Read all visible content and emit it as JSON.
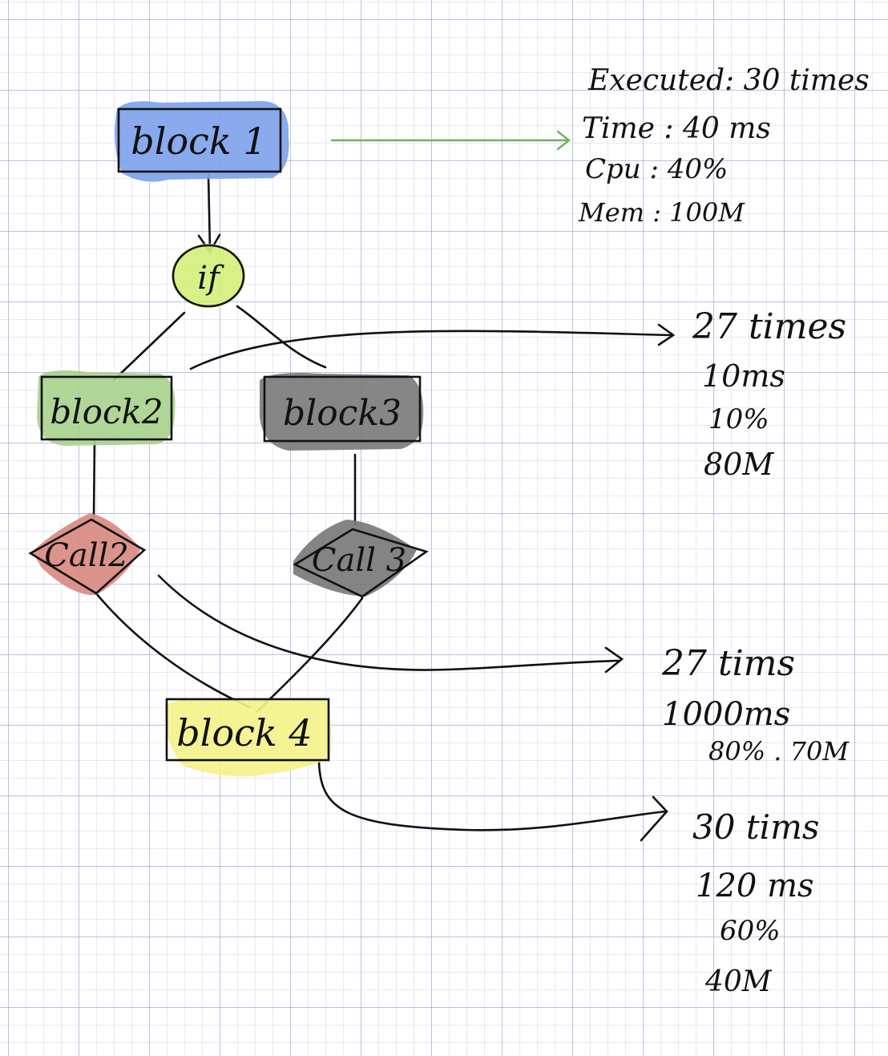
{
  "colors": {
    "block1": "#7fa3ea",
    "if": "#d4f07c",
    "block2": "#a9d28f",
    "block3": "#7c7c7c",
    "call2": "#d98a82",
    "call3": "#7a7a7a",
    "block4": "#f4f28a",
    "ink": "#111111",
    "highlight_arrow": "#6fb25a"
  },
  "nodes": {
    "block1": "block 1",
    "if": "if",
    "block2": "block2",
    "block3": "block3",
    "call2": "Call2",
    "call3": "Call 3",
    "block4": "block 4"
  },
  "stats": {
    "block1": {
      "executed": "Executed: 30 times",
      "time": "Time : 40 ms",
      "cpu": "Cpu : 40%",
      "mem": "Mem : 100M"
    },
    "branch": {
      "times": "27 times",
      "time": "10ms",
      "cpu": "10%",
      "mem": "80M"
    },
    "call2": {
      "times": "27 tims",
      "time": "1000ms",
      "cpu_mem": "80% . 70M"
    },
    "block4": {
      "times": "30 tims",
      "time": "120 ms",
      "cpu": "60%",
      "mem": "40M"
    }
  }
}
